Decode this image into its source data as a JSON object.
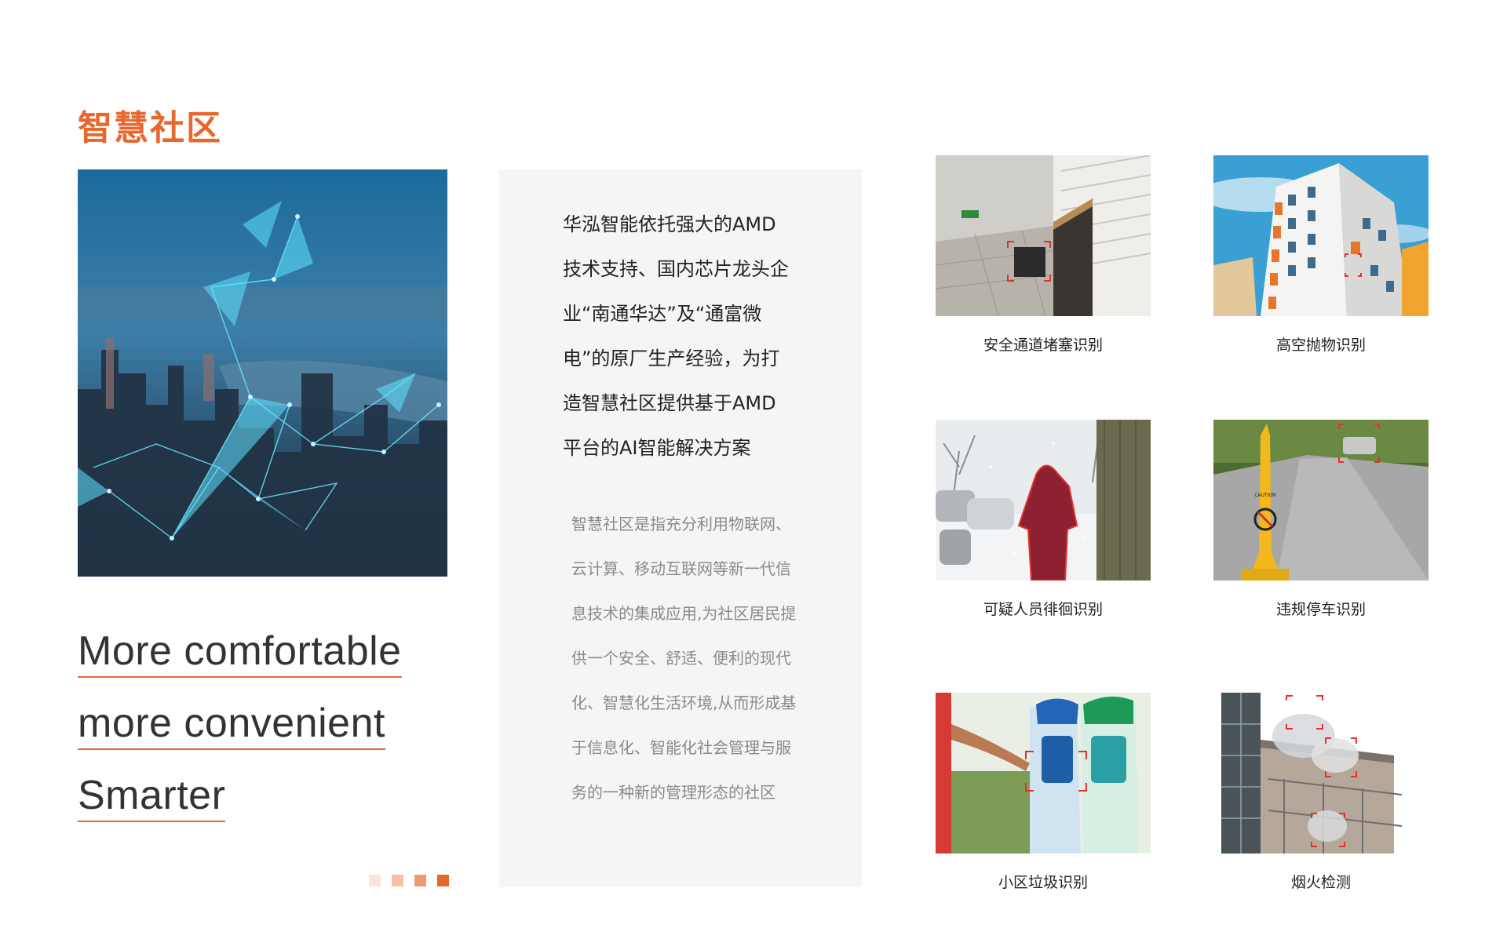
{
  "page": {
    "title": "智慧社区"
  },
  "hero": {
    "image": "smart-city-network-photo"
  },
  "slogans": [
    "More comfortable",
    "more convenient",
    "Smarter"
  ],
  "pager": {
    "dots": [
      "#fbe4da",
      "#f5c0a6",
      "#ee9a70",
      "#e8672c"
    ]
  },
  "panel": {
    "lead_lines": [
      "华泓智能依托强大的AMD",
      "技术支持、国内芯片龙头企",
      "业“南通华达”及“通富微",
      "电”的原厂生产经验，为打",
      "造智慧社区提供基于AMD",
      "平台的AI智能解决方案"
    ],
    "body_lines": [
      "智慧社区是指充分利用物联网、",
      "云计算、移动互联网等新一代信",
      "息技术的集成应用,为社区居民提",
      "供一个安全、舒适、便利的现代",
      "化、智慧化生活环境,从而形成基",
      "于信息化、智能化社会管理与服",
      "务的一种新的管理形态的社区"
    ]
  },
  "features": [
    {
      "caption": "安全通道堵塞识别",
      "image": "stairwell-blocked-photo"
    },
    {
      "caption": "高空抛物识别",
      "image": "high-rise-building-photo"
    },
    {
      "caption": "可疑人员徘徊识别",
      "image": "person-in-snow-photo"
    },
    {
      "caption": "违规停车识别",
      "image": "no-parking-cone-photo"
    },
    {
      "caption": "小区垃圾识别",
      "image": "trash-bins-photo"
    },
    {
      "caption": "烟火检测",
      "image": "smoke-balcony-photo"
    }
  ],
  "colors": {
    "accent": "#e8672c",
    "panel_bg": "#f5f5f5",
    "detect_box": "#e53030"
  }
}
